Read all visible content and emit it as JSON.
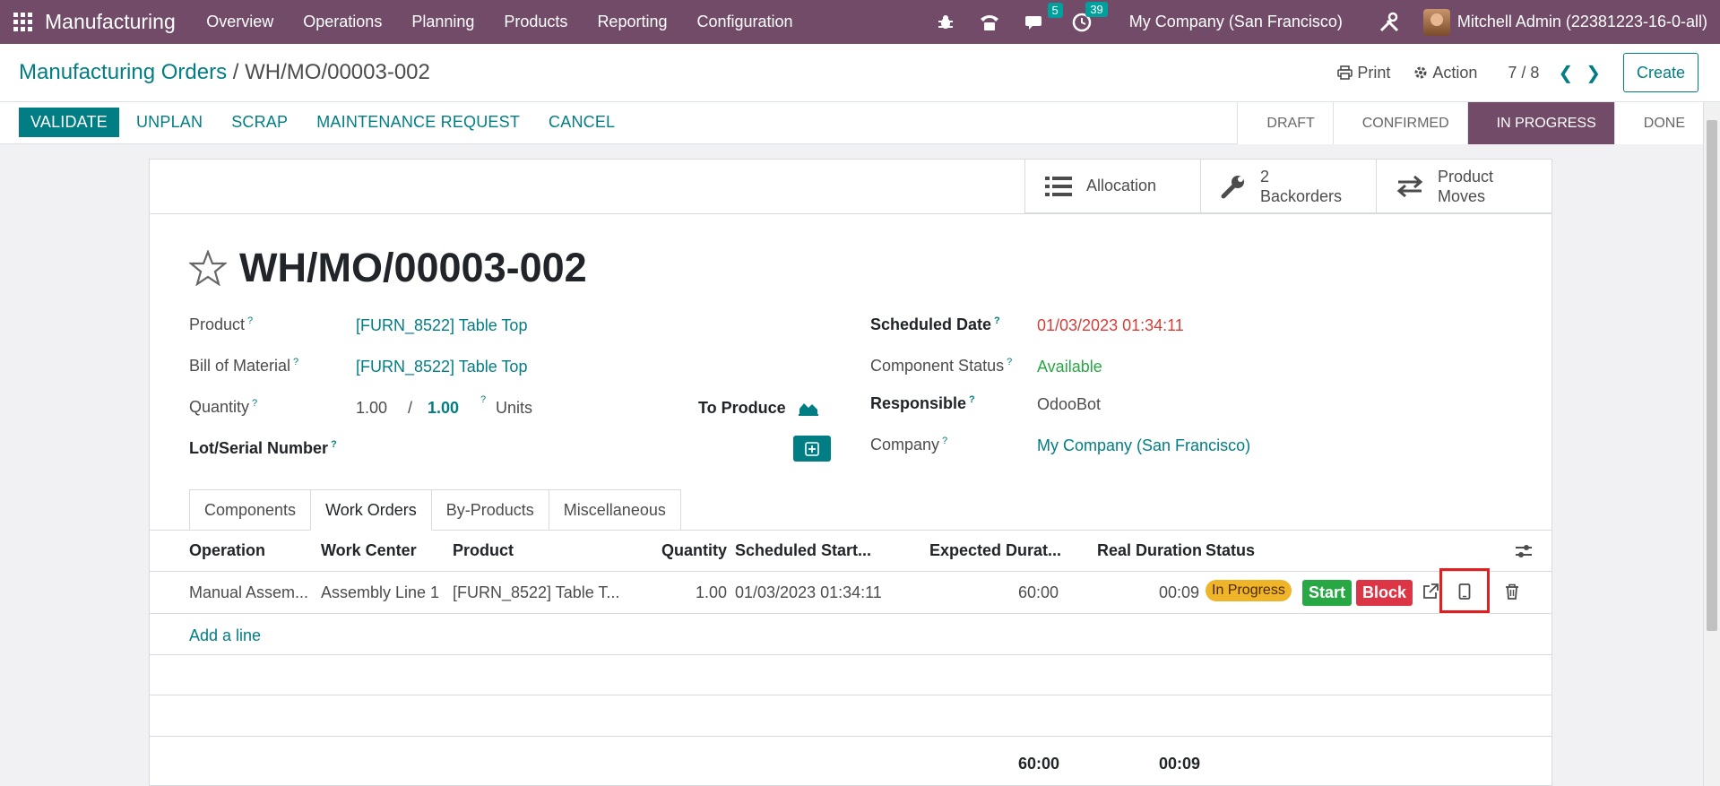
{
  "navbar": {
    "app_name": "Manufacturing",
    "menu": [
      "Overview",
      "Operations",
      "Planning",
      "Products",
      "Reporting",
      "Configuration"
    ],
    "messages_badge": "5",
    "activities_badge": "39",
    "company": "My Company (San Francisco)",
    "user": "Mitchell Admin (22381223-16-0-all)"
  },
  "control_panel": {
    "breadcrumb_parent": "Manufacturing Orders",
    "breadcrumb_sep": "/",
    "breadcrumb_current": "WH/MO/00003-002",
    "print_label": "Print",
    "action_label": "Action",
    "pager": "7 / 8",
    "create_label": "Create"
  },
  "statusbar": {
    "buttons": [
      "VALIDATE",
      "UNPLAN",
      "SCRAP",
      "MAINTENANCE REQUEST",
      "CANCEL"
    ],
    "stages": [
      "DRAFT",
      "CONFIRMED",
      "IN PROGRESS",
      "DONE"
    ],
    "active_stage": "IN PROGRESS"
  },
  "smart_buttons": {
    "allocation": "Allocation",
    "backorders_count": "2",
    "backorders_label": "Backorders",
    "product_moves_1": "Product",
    "product_moves_2": "Moves"
  },
  "form": {
    "title": "WH/MO/00003-002",
    "product_label": "Product",
    "product_value": "[FURN_8522] Table Top",
    "bom_label": "Bill of Material",
    "bom_value": "[FURN_8522] Table Top",
    "quantity_label": "Quantity",
    "quantity_produced": "1.00",
    "quantity_sep": "/",
    "quantity_total": "1.00",
    "quantity_uom": "Units",
    "to_produce_label": "To Produce",
    "lot_label": "Lot/Serial Number",
    "scheduled_label": "Scheduled Date",
    "scheduled_value": "01/03/2023 01:34:11",
    "component_status_label": "Component Status",
    "component_status_value": "Available",
    "responsible_label": "Responsible",
    "responsible_value": "OdooBot",
    "company_label": "Company",
    "company_value": "My Company (San Francisco)",
    "tooltip_mark": "?"
  },
  "tabs": [
    "Components",
    "Work Orders",
    "By-Products",
    "Miscellaneous"
  ],
  "active_tab": "Work Orders",
  "table": {
    "headers": {
      "operation": "Operation",
      "work_center": "Work Center",
      "product": "Product",
      "quantity": "Quantity",
      "scheduled_start": "Scheduled Start...",
      "expected_duration": "Expected Durat...",
      "real_duration": "Real Duration",
      "status": "Status"
    },
    "row": {
      "operation": "Manual Assem...",
      "work_center": "Assembly Line 1",
      "product": "[FURN_8522] Table T...",
      "quantity": "1.00",
      "scheduled_start": "01/03/2023 01:34:11",
      "expected_duration": "60:00",
      "real_duration": "00:09",
      "status": "In Progress",
      "start_label": "Start",
      "block_label": "Block"
    },
    "add_line": "Add a line",
    "total_expected": "60:00",
    "total_real": "00:09"
  },
  "colors": {
    "brand": "#714b67",
    "accent": "#017e84",
    "highlight": "#e02020"
  }
}
